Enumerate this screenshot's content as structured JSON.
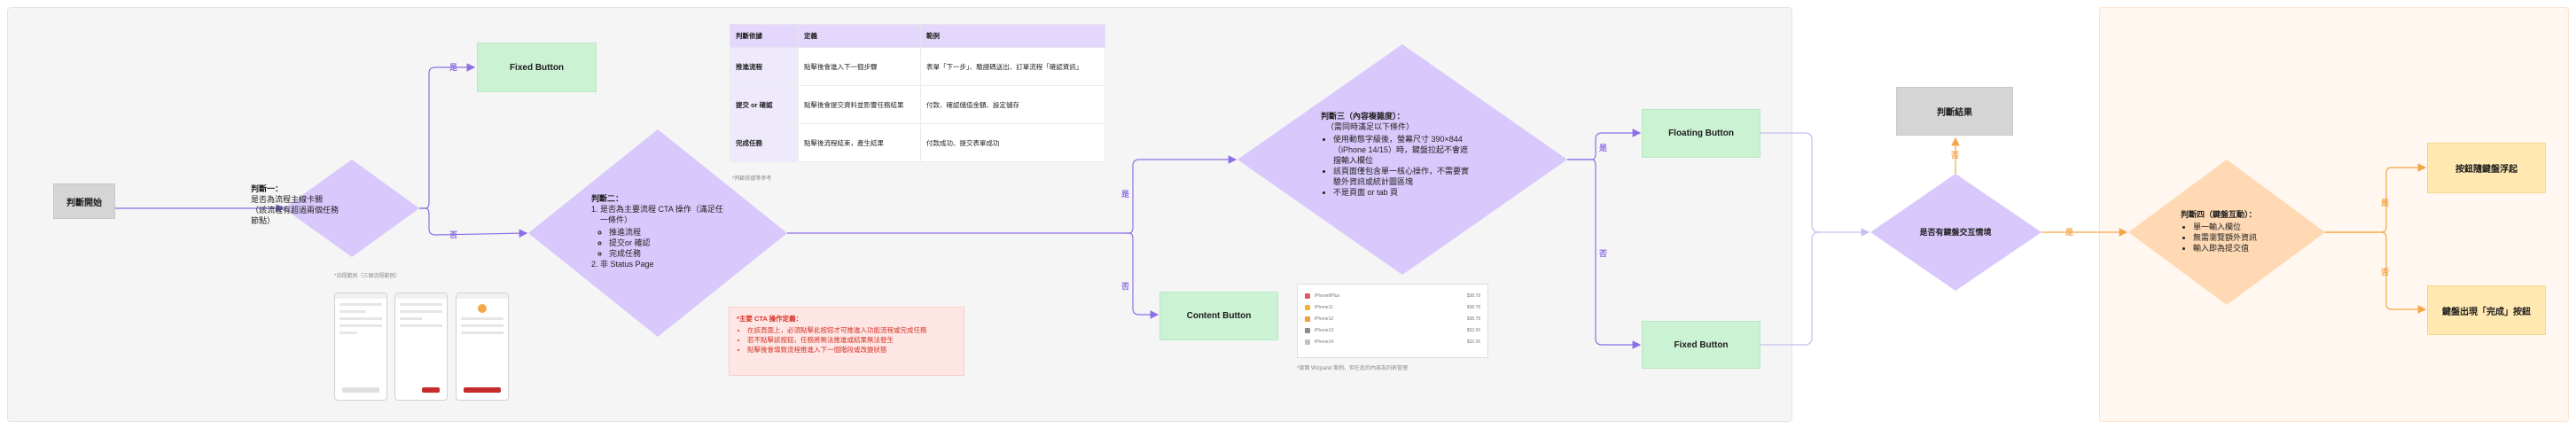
{
  "nodes": {
    "start": "判斷開始",
    "fixed_top": "Fixed Button",
    "floating": "Floating Button",
    "fixed_bottom": "Fixed Button",
    "content": "Content Button",
    "result": "判斷結果",
    "sticky": "按鈕隨鍵盤浮起",
    "keyboard_done": "鍵盤出現「完成」按鈕"
  },
  "decision1": {
    "title": "判斷一：",
    "lines": [
      "是否為流程主線卡關",
      "（該流程有超過兩個任務",
      "節點）"
    ]
  },
  "decision2": {
    "title": "判斷二：",
    "items": [
      "是否為主要流程 CTA 操作（滿足任一條件）",
      "推進流程",
      "提交or 確認",
      "完成任務",
      "非 Status Page"
    ]
  },
  "decision3": {
    "title": "判斷三（內容複雜度）：",
    "subtitle": "（需同時滿足以下條件）",
    "items": [
      "使用動態字級後，螢幕尺寸 390×844（iPhone 14/15）時，鍵盤拉起不會遮擋輸入欄位",
      "該頁面僅包含單一核心操作，不需要實驗外資訊或統計圖區塊",
      "不是頁面 or tab 頁"
    ]
  },
  "decision4": {
    "text": "是否有鍵盤交互情境"
  },
  "decision5": {
    "title": "判斷四（鍵盤互動）：",
    "items": [
      "單一輸入欄位",
      "無需瀏覽額外資訊",
      "輸入即為提交值"
    ]
  },
  "edges": {
    "d1_yes": "是",
    "d1_no": "否",
    "d2_yes": "是",
    "d2_no": "否",
    "d3_yes": "是",
    "d3_no": "否",
    "d4_yes": "是",
    "d4_no": "否",
    "d5_yes": "是",
    "d5_no": "否"
  },
  "table": {
    "headers": [
      "判斷依據",
      "定義",
      "範例"
    ],
    "rows": [
      [
        "推進流程",
        "點擊後會進入下一個步驟",
        "表單「下一步」、驗證碼送出、訂單流程「確認資訊」"
      ],
      [
        "提交 or 確認",
        "點擊後會提交資料並影響任務結果",
        "付款、確認儲值金額、設定儲存"
      ],
      [
        "完成任務",
        "點擊後流程結束，產生結果",
        "付款成功、提交表單成功"
      ]
    ],
    "note": "*判斷依據等參考"
  },
  "cta": {
    "title": "*主要 CTA 操作定義：",
    "items": [
      "在該頁面上，必須點擊此按鈕才可推進入功能流程或完成任務",
      "若不點擊該按鈕，任務將無法推進或結果無法發生",
      "點擊後會導致流程推進入下一個階段或改變狀態"
    ]
  },
  "notes": {
    "phones": "*流程範例（三個流程範例）",
    "list": "*頁面 Wizpand 案例，但在此的內容為列表管理"
  },
  "list_items": [
    {
      "label": "iPhone8Plus",
      "value": "$38.78"
    },
    {
      "label": "iPhone11",
      "value": "$38.78"
    },
    {
      "label": "iPhone12",
      "value": "$38.78"
    },
    {
      "label": "iPhone13",
      "value": "$32.36"
    },
    {
      "label": "iPhone14",
      "value": "$32.36"
    }
  ],
  "colors": {
    "purple": "#d8c8fb",
    "purple_line": "#8c6fe6",
    "orange": "#ffd9b3",
    "orange_line": "#f5a547",
    "green": "#ccf2d4",
    "yellow": "#ffe9b0",
    "red_text": "#d8342a"
  }
}
